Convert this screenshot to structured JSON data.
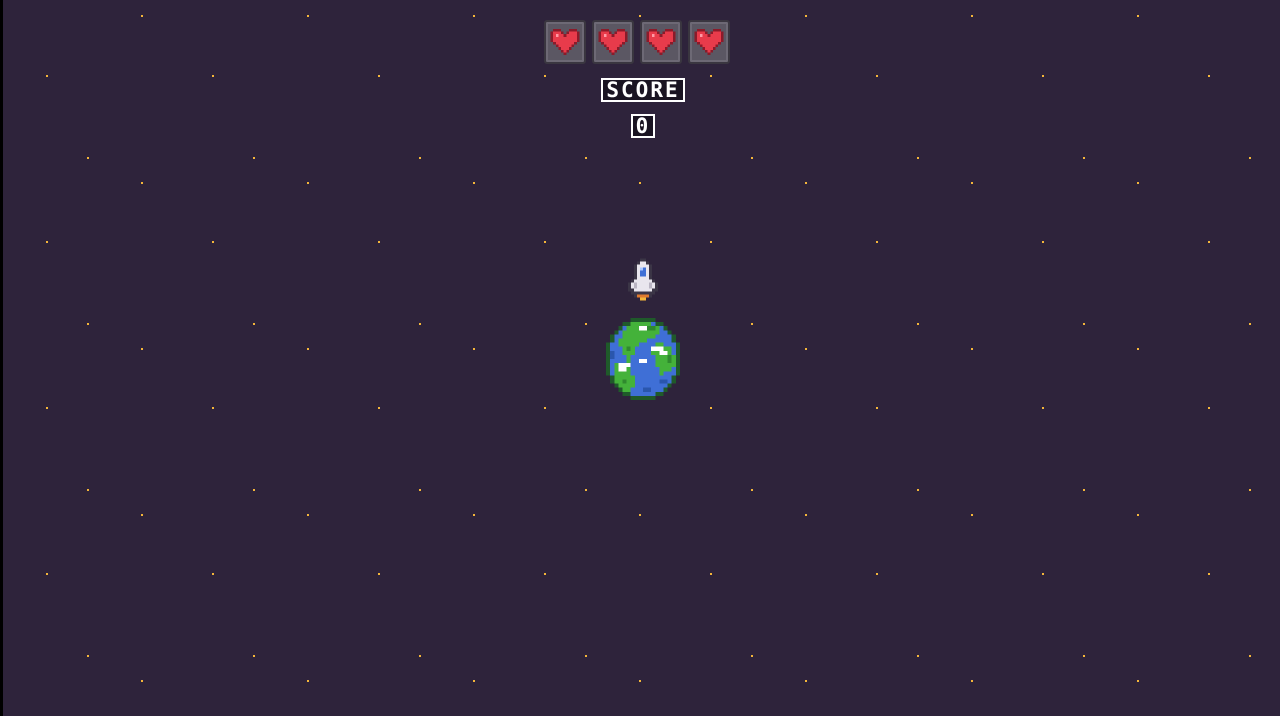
{
  "hud": {
    "lives_max": 4,
    "lives_remaining": 4,
    "score_label": "SCORE",
    "score_value": "0"
  },
  "colors": {
    "background": "#2e233b",
    "star": "#f4b63a",
    "heart": "#e83b4b",
    "heart_slot": "#5b5763",
    "planet_ocean": "#3f6fd6",
    "planet_land": "#44b23a"
  },
  "sprites": {
    "player": "rocket-ship",
    "home_planet": "earth-planet"
  }
}
